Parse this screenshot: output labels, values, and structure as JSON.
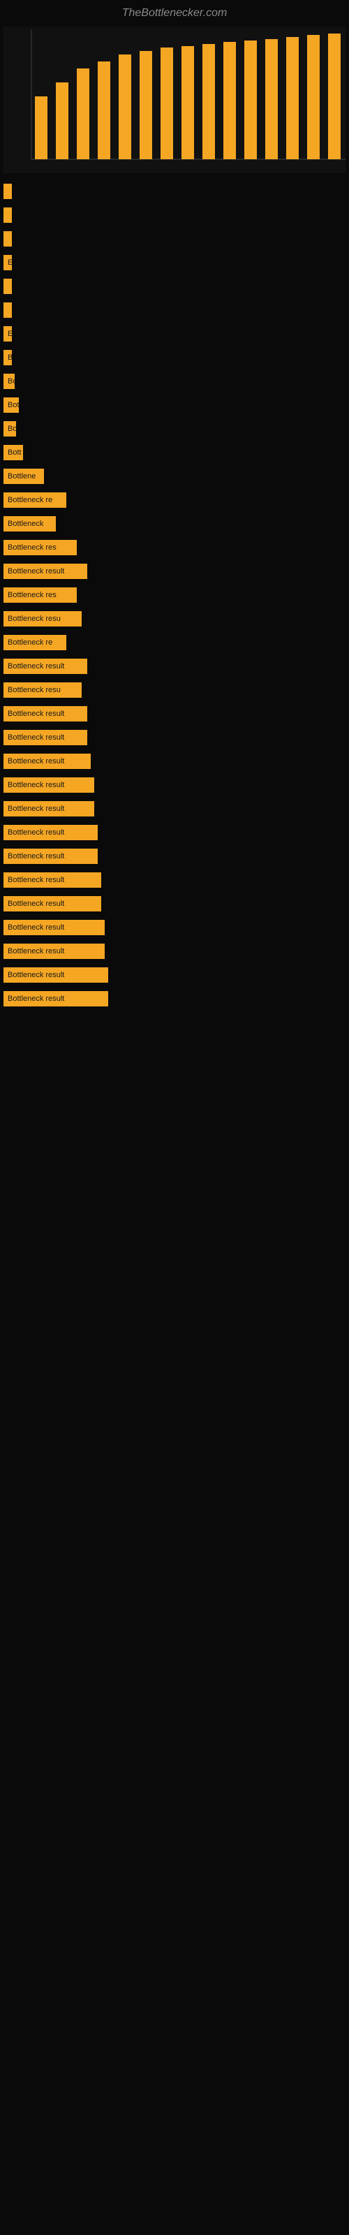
{
  "site": {
    "title": "TheBottlenecker.com"
  },
  "items": [
    {
      "label": "",
      "width": 2
    },
    {
      "label": "",
      "width": 4
    },
    {
      "label": "",
      "width": 4
    },
    {
      "label": "",
      "width": 6
    },
    {
      "label": "",
      "width": 4
    },
    {
      "label": "",
      "width": 4
    },
    {
      "label": "B",
      "width": 8
    },
    {
      "label": "B",
      "width": 10
    },
    {
      "label": "Bo",
      "width": 14
    },
    {
      "label": "Bot",
      "width": 18
    },
    {
      "label": "Bo",
      "width": 16
    },
    {
      "label": "Bott",
      "width": 22
    },
    {
      "label": "Bottlene",
      "width": 40
    },
    {
      "label": "Bottleneck re",
      "width": 75
    },
    {
      "label": "Bottleneck",
      "width": 60
    },
    {
      "label": "Bottleneck res",
      "width": 85
    },
    {
      "label": "Bottleneck result",
      "width": 100
    },
    {
      "label": "Bottleneck res",
      "width": 85
    },
    {
      "label": "Bottleneck resu",
      "width": 90
    },
    {
      "label": "Bottleneck re",
      "width": 75
    },
    {
      "label": "Bottleneck result",
      "width": 100
    },
    {
      "label": "Bottleneck resu",
      "width": 90
    },
    {
      "label": "Bottleneck result",
      "width": 100
    },
    {
      "label": "Bottleneck result",
      "width": 100
    },
    {
      "label": "Bottleneck result",
      "width": 105
    },
    {
      "label": "Bottleneck result",
      "width": 110
    },
    {
      "label": "Bottleneck result",
      "width": 110
    },
    {
      "label": "Bottleneck result",
      "width": 115
    },
    {
      "label": "Bottleneck result",
      "width": 115
    },
    {
      "label": "Bottleneck result",
      "width": 120
    },
    {
      "label": "Bottleneck result",
      "width": 120
    },
    {
      "label": "Bottleneck result",
      "width": 125
    },
    {
      "label": "Bottleneck result",
      "width": 125
    },
    {
      "label": "Bottleneck result",
      "width": 130
    },
    {
      "label": "Bottleneck result",
      "width": 130
    }
  ]
}
